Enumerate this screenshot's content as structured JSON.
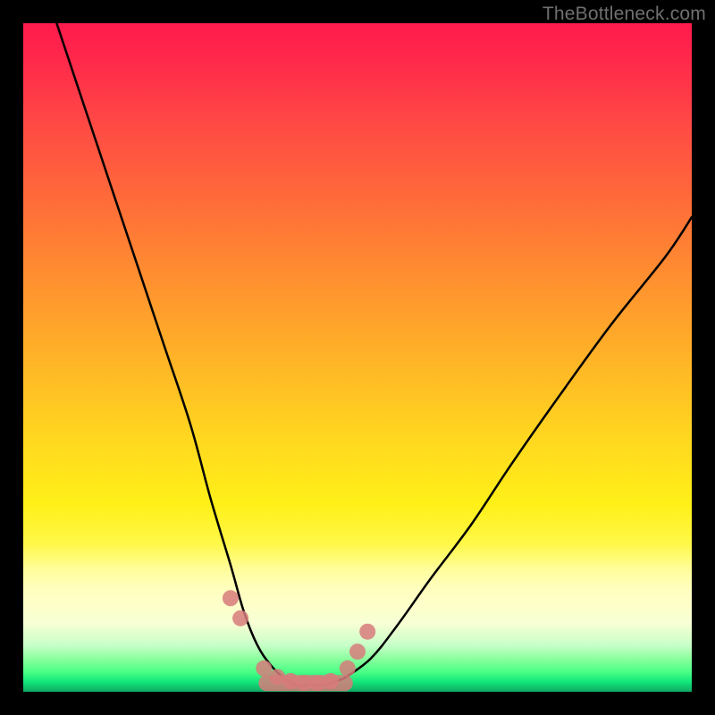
{
  "watermark": "TheBottleneck.com",
  "chart_data": {
    "type": "line",
    "title": "",
    "xlabel": "",
    "ylabel": "",
    "xlim": [
      0,
      100
    ],
    "ylim": [
      0,
      100
    ],
    "grid": false,
    "legend": false,
    "series": [
      {
        "name": "left-curve",
        "x": [
          5,
          9,
          13,
          17,
          21,
          25,
          28,
          31,
          33,
          35,
          37,
          39
        ],
        "values": [
          100,
          88,
          76,
          64,
          52,
          40,
          29,
          19,
          12,
          7,
          4,
          2
        ]
      },
      {
        "name": "right-curve",
        "x": [
          48,
          52,
          56,
          61,
          67,
          73,
          80,
          88,
          96,
          100
        ],
        "values": [
          2,
          5,
          10,
          17,
          25,
          34,
          44,
          55,
          65,
          71
        ]
      },
      {
        "name": "bottom-flat",
        "x": [
          39,
          41,
          43,
          45,
          48
        ],
        "values": [
          2,
          1,
          1,
          1,
          2
        ]
      }
    ],
    "markers": {
      "name": "pink-dots",
      "color": "#d77b7b",
      "x": [
        31.0,
        32.5,
        36.0,
        38.0,
        40.0,
        42.0,
        44.0,
        46.0,
        48.5,
        50.0,
        51.5
      ],
      "values": [
        14.0,
        11.0,
        3.5,
        2.2,
        1.6,
        1.3,
        1.3,
        1.6,
        3.5,
        6.0,
        9.0
      ]
    },
    "gradient_stops": [
      {
        "pos": 0,
        "color": "#ff1a4d"
      },
      {
        "pos": 50,
        "color": "#ffb327"
      },
      {
        "pos": 80,
        "color": "#fffb5a"
      },
      {
        "pos": 100,
        "color": "#0fa862"
      }
    ]
  }
}
